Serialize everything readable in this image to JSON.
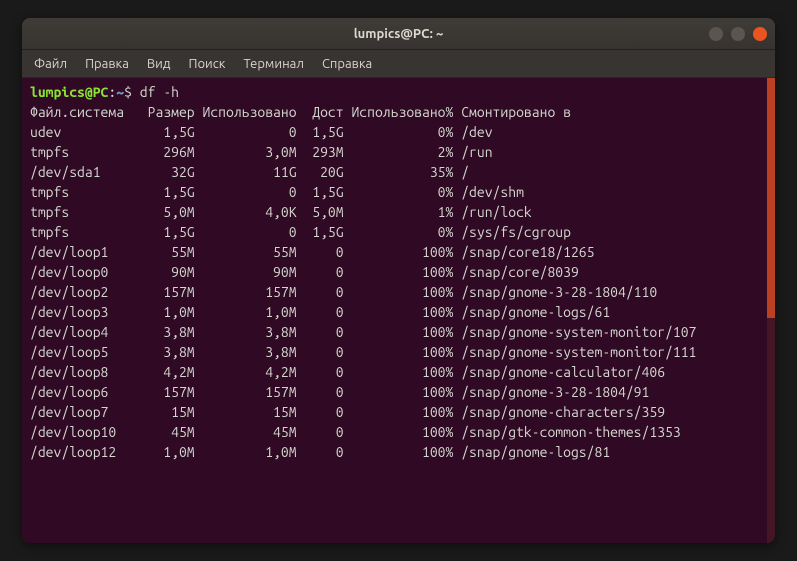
{
  "window": {
    "title": "lumpics@PC: ~"
  },
  "menu": {
    "items": [
      "Файл",
      "Правка",
      "Вид",
      "Поиск",
      "Терминал",
      "Справка"
    ]
  },
  "prompt": {
    "user": "lumpics",
    "at": "@",
    "host": "PC",
    "colon": ":",
    "path": "~",
    "dollar": "$",
    "command": "df -h"
  },
  "header": {
    "fs": "Файл.система",
    "size": "Размер",
    "used": "Использовано",
    "avail": "Дост",
    "pct": "Использовано%",
    "mount": "Смонтировано в"
  },
  "rows": [
    {
      "fs": "udev",
      "size": "1,5G",
      "used": "0",
      "avail": "1,5G",
      "pct": "0%",
      "mount": "/dev"
    },
    {
      "fs": "tmpfs",
      "size": "296M",
      "used": "3,0M",
      "avail": "293M",
      "pct": "2%",
      "mount": "/run"
    },
    {
      "fs": "/dev/sda1",
      "size": "32G",
      "used": "11G",
      "avail": "20G",
      "pct": "35%",
      "mount": "/"
    },
    {
      "fs": "tmpfs",
      "size": "1,5G",
      "used": "0",
      "avail": "1,5G",
      "pct": "0%",
      "mount": "/dev/shm"
    },
    {
      "fs": "tmpfs",
      "size": "5,0M",
      "used": "4,0K",
      "avail": "5,0M",
      "pct": "1%",
      "mount": "/run/lock"
    },
    {
      "fs": "tmpfs",
      "size": "1,5G",
      "used": "0",
      "avail": "1,5G",
      "pct": "0%",
      "mount": "/sys/fs/cgroup"
    },
    {
      "fs": "/dev/loop1",
      "size": "55M",
      "used": "55M",
      "avail": "0",
      "pct": "100%",
      "mount": "/snap/core18/1265"
    },
    {
      "fs": "/dev/loop0",
      "size": "90M",
      "used": "90M",
      "avail": "0",
      "pct": "100%",
      "mount": "/snap/core/8039"
    },
    {
      "fs": "/dev/loop2",
      "size": "157M",
      "used": "157M",
      "avail": "0",
      "pct": "100%",
      "mount": "/snap/gnome-3-28-1804/110"
    },
    {
      "fs": "/dev/loop3",
      "size": "1,0M",
      "used": "1,0M",
      "avail": "0",
      "pct": "100%",
      "mount": "/snap/gnome-logs/61"
    },
    {
      "fs": "/dev/loop4",
      "size": "3,8M",
      "used": "3,8M",
      "avail": "0",
      "pct": "100%",
      "mount": "/snap/gnome-system-monitor/107"
    },
    {
      "fs": "/dev/loop5",
      "size": "3,8M",
      "used": "3,8M",
      "avail": "0",
      "pct": "100%",
      "mount": "/snap/gnome-system-monitor/111"
    },
    {
      "fs": "/dev/loop8",
      "size": "4,2M",
      "used": "4,2M",
      "avail": "0",
      "pct": "100%",
      "mount": "/snap/gnome-calculator/406"
    },
    {
      "fs": "/dev/loop6",
      "size": "157M",
      "used": "157M",
      "avail": "0",
      "pct": "100%",
      "mount": "/snap/gnome-3-28-1804/91"
    },
    {
      "fs": "/dev/loop7",
      "size": "15M",
      "used": "15M",
      "avail": "0",
      "pct": "100%",
      "mount": "/snap/gnome-characters/359"
    },
    {
      "fs": "/dev/loop10",
      "size": "45M",
      "used": "45M",
      "avail": "0",
      "pct": "100%",
      "mount": "/snap/gtk-common-themes/1353"
    },
    {
      "fs": "/dev/loop12",
      "size": "1,0M",
      "used": "1,0M",
      "avail": "0",
      "pct": "100%",
      "mount": "/snap/gnome-logs/81"
    }
  ],
  "cols": {
    "fs": 14,
    "size": 6,
    "used": 12,
    "avail": 5,
    "pct": 13,
    "total": 88
  }
}
